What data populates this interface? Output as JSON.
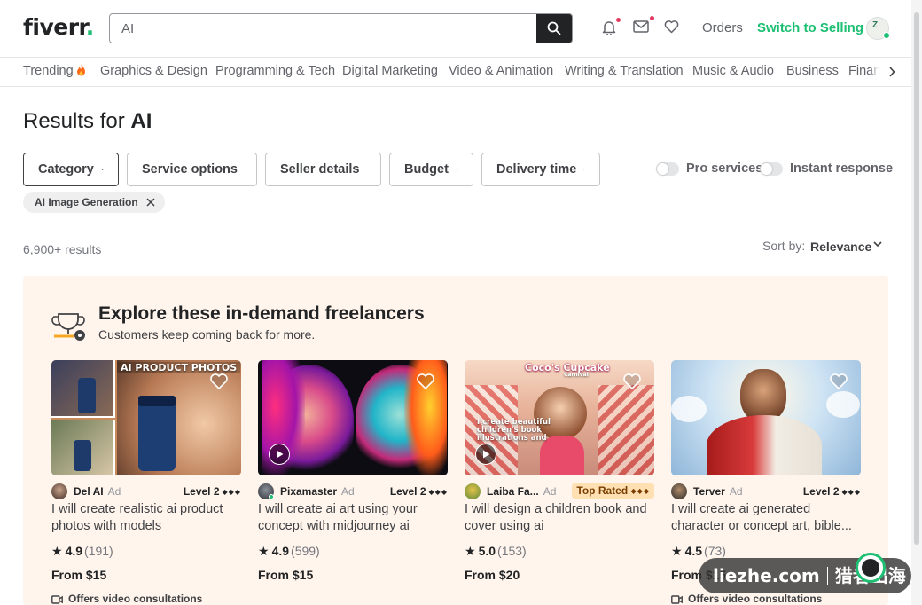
{
  "header": {
    "logo_text": "fiverr",
    "logo_dot": ".",
    "search_value": "AI",
    "orders_label": "Orders",
    "switch_label": "Switch to Selling",
    "icons": [
      "search-icon",
      "bell-icon",
      "mail-icon",
      "heart-icon"
    ]
  },
  "categories": [
    "Trending",
    "Graphics & Design",
    "Programming & Tech",
    "Digital Marketing",
    "Video & Animation",
    "Writing & Translation",
    "Music & Audio",
    "Business",
    "Finance"
  ],
  "results": {
    "title_prefix": "Results for",
    "query": "AI",
    "count": "6,900+ results",
    "sort_label": "Sort by:",
    "sort_value": "Relevance"
  },
  "filters": [
    "Category",
    "Service options",
    "Seller details",
    "Budget",
    "Delivery time"
  ],
  "toggles": {
    "pro": "Pro services",
    "instant": "Instant response"
  },
  "active_chip": "AI Image Generation",
  "explore": {
    "title": "Explore these in-demand freelancers",
    "subtitle": "Customers keep coming back for more."
  },
  "cards": [
    {
      "thumb_text": "AI PRODUCT PHOTOS",
      "seller": "Del AI",
      "ad": "Ad",
      "badge": "Level 2",
      "badge_dots": "◆◆◆",
      "title": "I will create realistic ai product photos with models",
      "rating": "4.9",
      "reviews": "(191)",
      "price": "From $15",
      "video": "Offers video consultations"
    },
    {
      "thumb_text": "",
      "seller": "Pixamaster",
      "ad": "Ad",
      "badge": "Level 2",
      "badge_dots": "◆◆◆",
      "title": "I will create ai art using your concept with midjourney ai",
      "rating": "4.9",
      "reviews": "(599)",
      "price": "From $15",
      "video": ""
    },
    {
      "thumb_text": "Coco's Cupcake",
      "thumb_text2": "Carnival",
      "thumb_text3": "I create beautiful children's book illustrations and",
      "seller": "Laiba Fa...",
      "ad": "Ad",
      "badge": "Top Rated",
      "badge_dots": "◆◆◆",
      "title": "I will design a children book and cover using ai",
      "rating": "5.0",
      "reviews": "(153)",
      "price": "From $20",
      "video": ""
    },
    {
      "thumb_text": "",
      "seller": "Terver",
      "ad": "Ad",
      "badge": "Level 2",
      "badge_dots": "◆◆◆",
      "title": "I will create ai generated character or concept art, bible...",
      "rating": "4.5",
      "reviews": "(73)",
      "price": "From $15",
      "video": "Offers video consultations"
    }
  ],
  "watermark": {
    "latin": "liezhe.com",
    "cjk": "猎者出海"
  },
  "colors": {
    "brand_green": "#1dbf73",
    "text_dark": "#222325",
    "text_mid": "#404145",
    "explore_bg": "#fff5ec",
    "top_rated_bg": "#ffe0b3"
  }
}
